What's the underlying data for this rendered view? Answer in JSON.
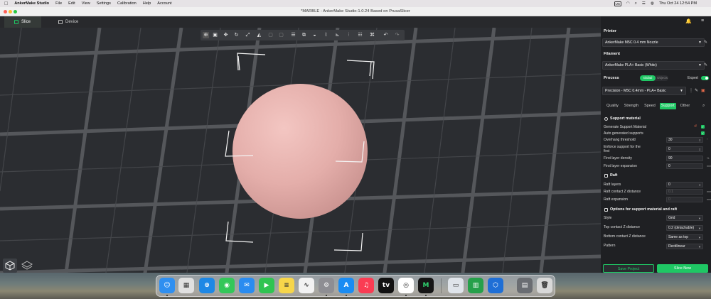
{
  "menubar": {
    "app": "AnkerMake Studio",
    "items": [
      "File",
      "Edit",
      "View",
      "Settings",
      "Calibration",
      "Help",
      "Account"
    ],
    "input_source": "US",
    "datetime": "Thu Oct 24  12:54 PM"
  },
  "window": {
    "title": "*MARBLE - AnkerMake Studio-1.0.24 Based on PrusaSlicer"
  },
  "tabs": [
    {
      "label": "Slice",
      "active": true
    },
    {
      "label": "Device",
      "active": false
    }
  ],
  "toolbar": {
    "icons": [
      "add-object-icon",
      "arrange-icon",
      "move-icon",
      "rotate-icon",
      "scale-icon",
      "cut-icon",
      "copy-icon",
      "paste-icon",
      "layers-icon",
      "split-icon",
      "support-paint-icon",
      "seam-paint-icon",
      "measure-icon",
      "variable-layer-icon",
      "assemble-icon",
      "undo-icon",
      "redo-icon"
    ]
  },
  "panel": {
    "printer": {
      "heading": "Printer",
      "value": "AnkerMake M5C 0.4 mm Nozzle"
    },
    "filament": {
      "heading": "Filament",
      "value": "AnkerMake PLA+ Basic (White)"
    },
    "process": {
      "heading": "Process",
      "global": "Global",
      "objects": "Objects",
      "expert": "Expert",
      "expert_on": true,
      "value": "Precision - M5C 0.4mm - PLA+ Basic"
    },
    "tabs": [
      "Quality",
      "Strength",
      "Speed",
      "Support",
      "Other"
    ],
    "active_tab": "Support",
    "support_material": {
      "heading": "Support material",
      "rows": [
        {
          "label": "Generate Support Material",
          "checked": true
        },
        {
          "label": "Auto generated supports",
          "checked": true
        },
        {
          "label": "Overhang threshold",
          "value": "30",
          "unit": "°"
        },
        {
          "label": "Enforce support for the",
          "label2": "first",
          "value": "0"
        },
        {
          "label": "First layer density",
          "value": "90",
          "unit": "%"
        },
        {
          "label": "First layer expansion",
          "value": "0",
          "unit": "mm"
        }
      ]
    },
    "raft": {
      "heading": "Raft",
      "rows": [
        {
          "label": "Raft layers",
          "value": "0"
        },
        {
          "label": "Raft contact Z distance",
          "value": "0.1",
          "unit": "mm"
        },
        {
          "label": "Raft expansion",
          "value": "0",
          "unit": "mm"
        }
      ]
    },
    "options": {
      "heading": "Options for support material and raft",
      "rows": [
        {
          "label": "Style",
          "value": "Grid"
        },
        {
          "label": "Top contact Z distance",
          "value": "0.2 (detachable)"
        },
        {
          "label": "Bottom contact Z distance",
          "value": "Same as top"
        },
        {
          "label": "Pattern",
          "value": "Rectilinear"
        }
      ]
    },
    "save_label": "Save Project",
    "slice_label": "Slice Now"
  },
  "colors": {
    "accent": "#1fc764",
    "model": "#e7b3ae",
    "background": "#2b2d31",
    "grid": "#5a5c60"
  },
  "dock": {
    "apps": [
      {
        "name": "finder-icon",
        "color": "#2f8ff0",
        "glyph": "☺"
      },
      {
        "name": "launchpad-icon",
        "color": "#e0e0e0",
        "glyph": "▦"
      },
      {
        "name": "safari-icon",
        "color": "#1e88e5",
        "glyph": "⊕"
      },
      {
        "name": "messages-icon",
        "color": "#34c759",
        "glyph": "◉"
      },
      {
        "name": "mail-icon",
        "color": "#2a8cf0",
        "glyph": "✉"
      },
      {
        "name": "facetime-icon",
        "color": "#30c451",
        "glyph": "▶"
      },
      {
        "name": "notes-icon",
        "color": "#f7d64a",
        "glyph": "≡"
      },
      {
        "name": "freeform-icon",
        "color": "#f2f2f2",
        "glyph": "∿"
      },
      {
        "name": "system-settings-icon",
        "color": "#8e8e93",
        "glyph": "⚙"
      },
      {
        "name": "app-store-icon",
        "color": "#1a8cf3",
        "glyph": "A"
      },
      {
        "name": "music-icon",
        "color": "#fa3c53",
        "glyph": "♫"
      },
      {
        "name": "apple-tv-icon",
        "color": "#111111",
        "glyph": "tv"
      },
      {
        "name": "chrome-icon",
        "color": "#ffffff",
        "glyph": "◎"
      },
      {
        "name": "ankermake-icon",
        "color": "#161616",
        "glyph": "M"
      },
      {
        "name": "preview-icon",
        "color": "#dfe4ea",
        "glyph": "▭"
      },
      {
        "name": "numbers-icon",
        "color": "#26a04a",
        "glyph": "▥"
      },
      {
        "name": "xcode-icon",
        "color": "#1f6fd6",
        "glyph": "⬡"
      },
      {
        "name": "downloads-stack-icon",
        "color": "#6a6d72",
        "glyph": "▤"
      },
      {
        "name": "trash-icon",
        "color": "#d8d8d8",
        "glyph": "🗑"
      }
    ]
  }
}
